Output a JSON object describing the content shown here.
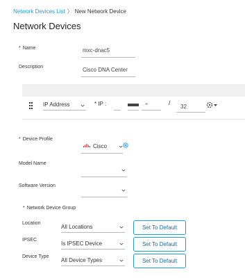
{
  "breadcrumb": {
    "parent": "Network Devices List",
    "separator": "〉",
    "current": "New Network Device"
  },
  "page": {
    "title": "Network Devices"
  },
  "fields": {
    "required_mark": "*",
    "name_label": "Name",
    "name_value": "mxc-dnac5",
    "description_label": "Description",
    "description_value": "Cisco DNA Center",
    "ip_type": "IP Address",
    "ip_label": "* IP :",
    "ip_separator": ".",
    "ip_sep2": ". ≡",
    "ip_slash": "/",
    "ip_mask": "32",
    "device_profile_label": "Device Profile",
    "device_profile_value": "Cisco",
    "model_name_label": "Model Name",
    "software_version_label": "Software Version",
    "ndg_label": "Network Device Group",
    "location_label": "Location",
    "location_value": "All Locations",
    "ipsec_label": "IPSEC",
    "ipsec_value": "Is IPSEC Device",
    "device_type_label": "Device Type",
    "device_type_value": "All Device Types",
    "set_default_label": "Set To Default"
  },
  "colors": {
    "link": "#1a9fd6",
    "button_border": "#1a9fd6"
  },
  "icons": [
    "chevron-down-icon",
    "grip-icon",
    "gear-icon",
    "add-circle-icon",
    "cisco-logo-icon"
  ]
}
